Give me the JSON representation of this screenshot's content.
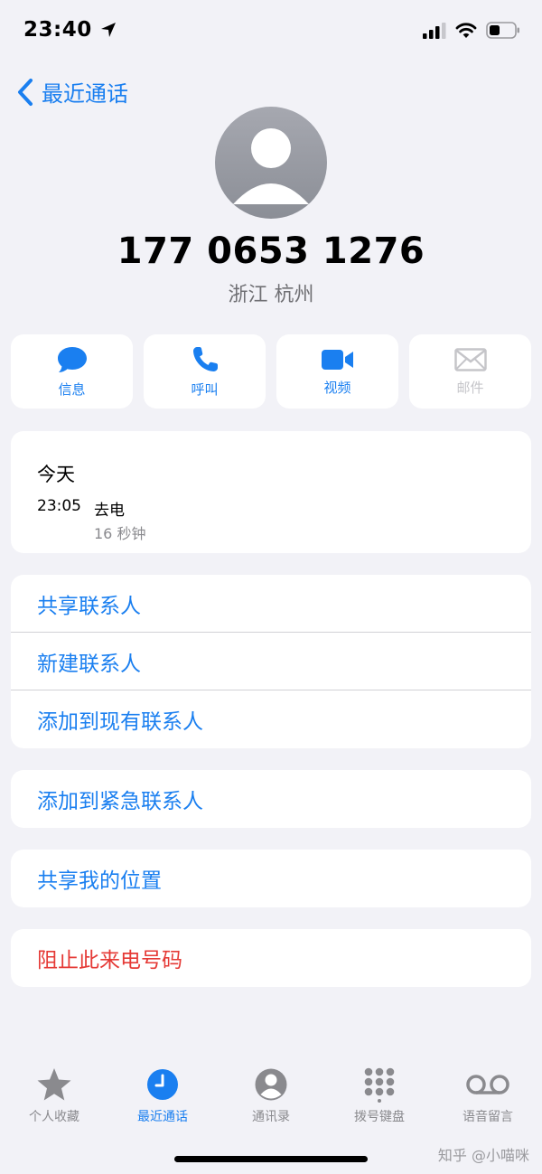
{
  "status": {
    "time": "23:40"
  },
  "nav": {
    "back_label": "最近通话"
  },
  "contact": {
    "number": "177 0653 1276",
    "location": "浙江 杭州"
  },
  "actions": [
    {
      "label": "信息",
      "icon": "message-icon",
      "enabled": true
    },
    {
      "label": "呼叫",
      "icon": "phone-icon",
      "enabled": true
    },
    {
      "label": "视频",
      "icon": "video-icon",
      "enabled": true
    },
    {
      "label": "邮件",
      "icon": "mail-icon",
      "enabled": false
    }
  ],
  "history": {
    "day": "今天",
    "time": "23:05",
    "type": "去电",
    "duration": "16 秒钟"
  },
  "options": {
    "share_contact": "共享联系人",
    "new_contact": "新建联系人",
    "add_existing": "添加到现有联系人",
    "add_emergency": "添加到紧急联系人",
    "share_location": "共享我的位置",
    "block": "阻止此来电号码"
  },
  "tabs": [
    {
      "label": "个人收藏",
      "icon": "star-icon"
    },
    {
      "label": "最近通话",
      "icon": "clock-icon",
      "active": true
    },
    {
      "label": "通讯录",
      "icon": "person-icon"
    },
    {
      "label": "拨号键盘",
      "icon": "keypad-icon"
    },
    {
      "label": "语音留言",
      "icon": "voicemail-icon"
    }
  ],
  "watermark": "知乎 @小喵咪",
  "colors": {
    "accent": "#1a7ff0",
    "destructive": "#e53935",
    "background": "#f2f2f7"
  }
}
